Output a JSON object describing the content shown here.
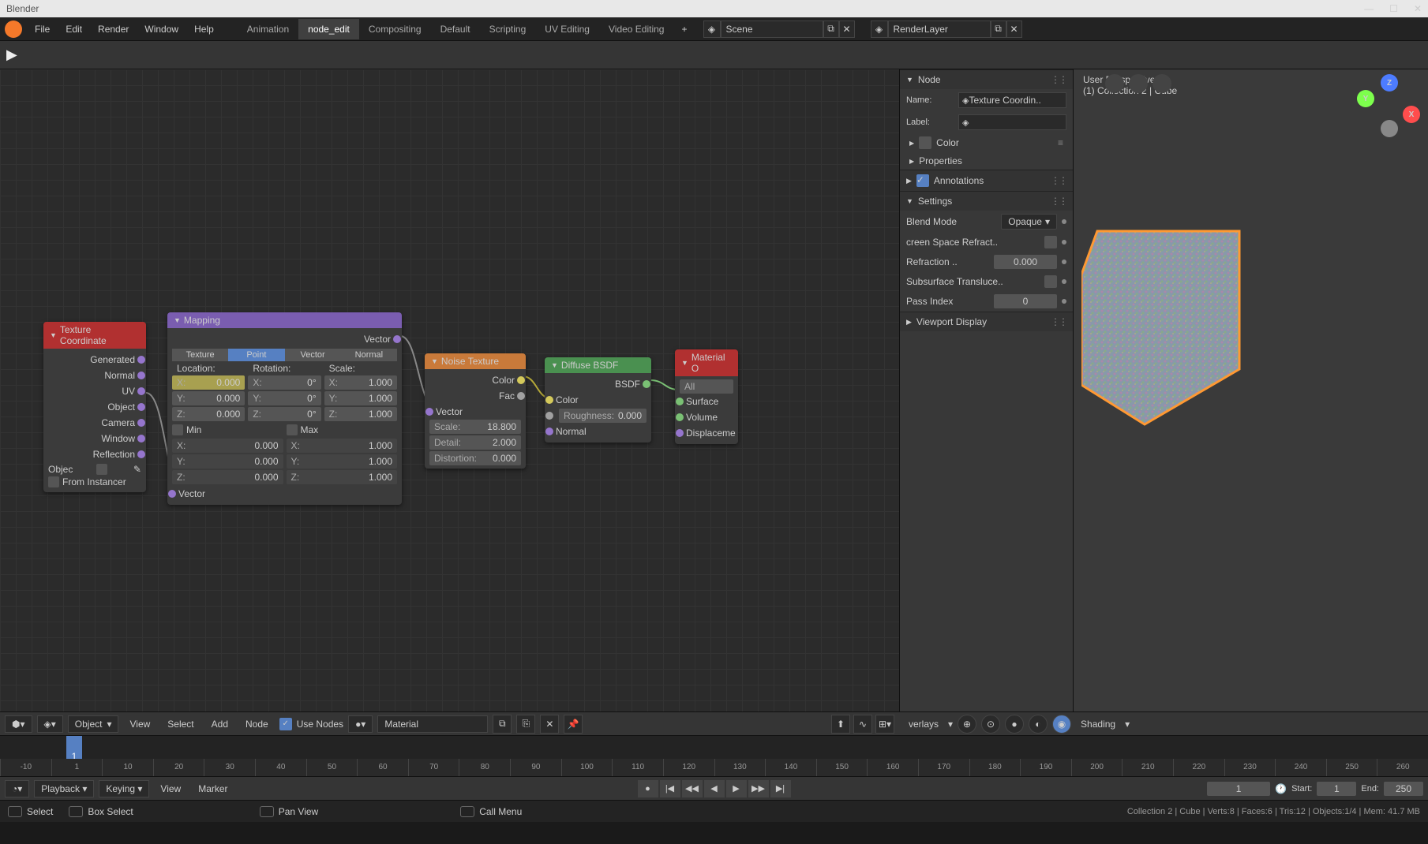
{
  "app": {
    "title": "Blender"
  },
  "win_controls": {
    "min": "—",
    "max": "☐",
    "close": "✕"
  },
  "topmenu": [
    "File",
    "Edit",
    "Render",
    "Window",
    "Help"
  ],
  "tabs": [
    "Animation",
    "node_edit",
    "Compositing",
    "Default",
    "Scripting",
    "UV Editing",
    "Video Editing"
  ],
  "active_tab": 1,
  "scene": {
    "value": "Scene"
  },
  "renderlayer": {
    "value": "RenderLayer"
  },
  "nodes": {
    "tex_coord": {
      "title": "Texture Coordinate",
      "outputs": [
        "Generated",
        "Normal",
        "UV",
        "Object",
        "Camera",
        "Window",
        "Reflection"
      ],
      "object_label": "Objec",
      "from_instancer": "From Instancer"
    },
    "mapping": {
      "title": "Mapping",
      "out": "Vector",
      "tabs": [
        "Texture",
        "Point",
        "Vector",
        "Normal"
      ],
      "active_tab": 1,
      "col_labels": [
        "Location:",
        "Rotation:",
        "Scale:"
      ],
      "loc": [
        {
          "a": "X:",
          "v": "0.000"
        },
        {
          "a": "Y:",
          "v": "0.000"
        },
        {
          "a": "Z:",
          "v": "0.000"
        }
      ],
      "rot": [
        {
          "a": "X:",
          "v": "0°"
        },
        {
          "a": "Y:",
          "v": "0°"
        },
        {
          "a": "Z:",
          "v": "0°"
        }
      ],
      "scale": [
        {
          "a": "X:",
          "v": "1.000"
        },
        {
          "a": "Y:",
          "v": "1.000"
        },
        {
          "a": "Z:",
          "v": "1.000"
        }
      ],
      "min_label": "Min",
      "max_label": "Max",
      "min": [
        {
          "a": "X:",
          "v": "0.000"
        },
        {
          "a": "Y:",
          "v": "0.000"
        },
        {
          "a": "Z:",
          "v": "0.000"
        }
      ],
      "max": [
        {
          "a": "X:",
          "v": "1.000"
        },
        {
          "a": "Y:",
          "v": "1.000"
        },
        {
          "a": "Z:",
          "v": "1.000"
        }
      ],
      "in": "Vector"
    },
    "noise": {
      "title": "Noise Texture",
      "outs": [
        "Color",
        "Fac"
      ],
      "in_vector": "Vector",
      "scale": {
        "l": "Scale:",
        "v": "18.800"
      },
      "detail": {
        "l": "Detail:",
        "v": "2.000"
      },
      "distortion": {
        "l": "Distortion:",
        "v": "0.000"
      }
    },
    "diffuse": {
      "title": "Diffuse BSDF",
      "out": "BSDF",
      "color": "Color",
      "roughness": {
        "l": "Roughness:",
        "v": "0.000"
      },
      "normal": "Normal"
    },
    "matout": {
      "title": "Material O",
      "all": "All",
      "surface": "Surface",
      "volume": "Volume",
      "displacement": "Displaceme"
    }
  },
  "material_label": "Material",
  "sidebar": {
    "node_h": "Node",
    "name_l": "Name:",
    "name_v": "Texture Coordin..",
    "label_l": "Label:",
    "color": "Color",
    "properties": "Properties",
    "annotations": "Annotations",
    "settings": "Settings",
    "blend_mode_l": "Blend Mode",
    "blend_mode_v": "Opaque",
    "ssr": "creen Space Refract..",
    "refraction_l": "Refraction ..",
    "refraction_v": "0.000",
    "subsurface": "Subsurface Transluce..",
    "passindex_l": "Pass Index",
    "passindex_v": "0",
    "viewport_display": "Viewport Display"
  },
  "viewport": {
    "line1": "User Perspective",
    "line2": "(1) Collection 2 | Cube"
  },
  "node_footer": {
    "mode": "Object",
    "menus": [
      "View",
      "Select",
      "Add",
      "Node"
    ],
    "use_nodes": "Use Nodes",
    "material": "Material"
  },
  "vp_footer": {
    "overlays": "verlays",
    "shading": "Shading"
  },
  "timeline": {
    "current": "1",
    "ticks": [
      "-10",
      "1",
      "10",
      "20",
      "30",
      "40",
      "50",
      "60",
      "70",
      "80",
      "90",
      "100",
      "110",
      "120",
      "130",
      "140",
      "150",
      "160",
      "170",
      "180",
      "190",
      "200",
      "210",
      "220",
      "230",
      "240",
      "250",
      "260"
    ]
  },
  "tl_controls": {
    "playback": "Playback",
    "keying": "Keying",
    "menus": [
      "View",
      "Marker"
    ],
    "frame": "1",
    "start_l": "Start:",
    "start_v": "1",
    "end_l": "End:",
    "end_v": "250"
  },
  "statusbar": {
    "select": "Select",
    "box": "Box Select",
    "pan": "Pan View",
    "call": "Call Menu",
    "stats": "Collection 2 | Cube | Verts:8 | Faces:6 | Tris:12 | Objects:1/4 | Mem: 41.7 MB"
  }
}
